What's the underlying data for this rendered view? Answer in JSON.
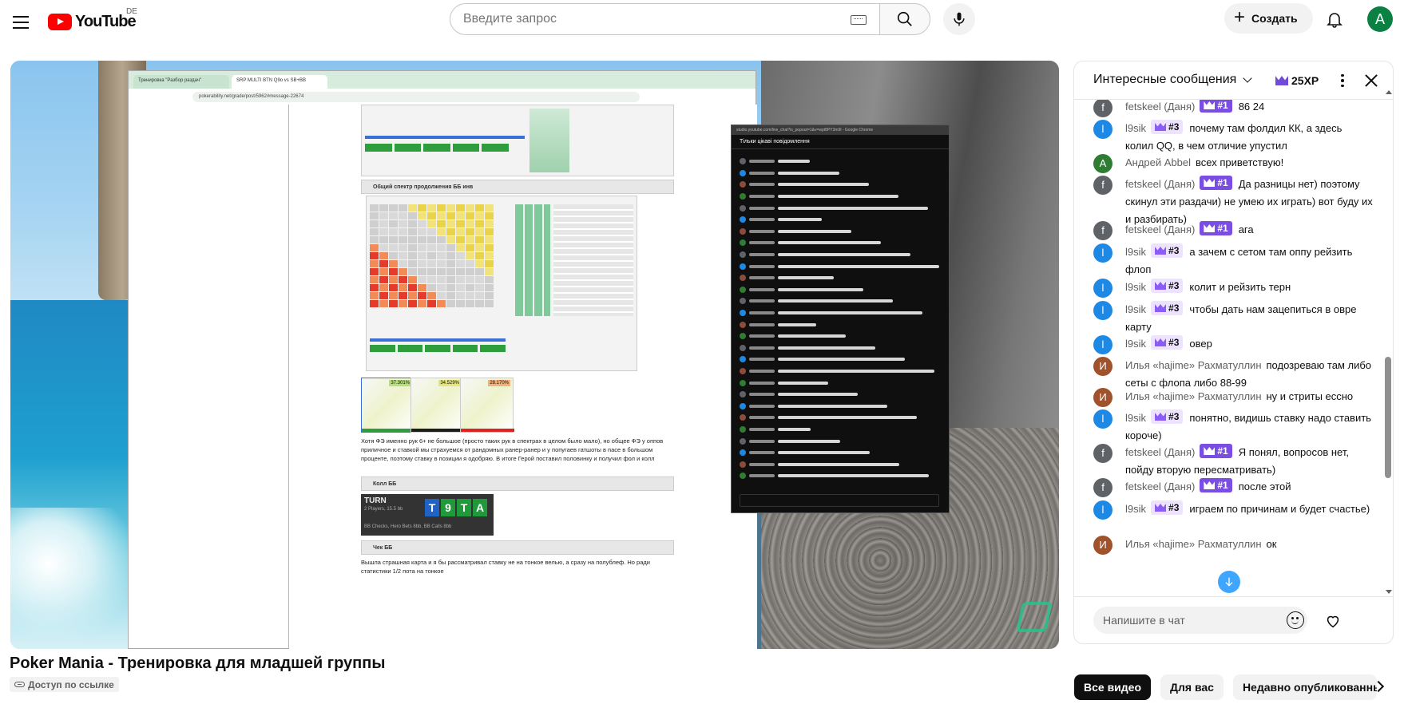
{
  "header": {
    "logo_text": "YouTube",
    "region": "DE",
    "search_placeholder": "Введите запрос",
    "create_label": "Создать",
    "avatar_letter": "A"
  },
  "video": {
    "title": "Poker Mania - Тренировка для младшей группы",
    "visibility": "Доступ по ссылке",
    "frame": {
      "tab_1": "Тренировка \"Разбор раздач\"",
      "tab_2": "SRP MULTI BTN Q9o vs SB+BB",
      "url": "pokerability.net/grade/post/5962#message-22674",
      "overlay_chat_bar": "studio.youtube.com/live_chat?is_popout=1&v=wpt8PY3m9l - Google Chrome",
      "overlay_chat_title": "Тільки цікаві повідомлення",
      "section_1": "Общий спектр продолжения ББ инв",
      "section_2": "Колл ББ",
      "section_3": "Чек ББ",
      "pct_1": "37.301%",
      "pct_2": "34.529%",
      "pct_3": "28.170%",
      "post_1": "Хотя ФЭ именно рук 6+ не большое (просто таких рук в спектрах в целом было мало), но общее ФЭ у оппов приличное и ставкой мы страхуемся от рандомных ранер-ранер и у попугаев гатшоты в пасе в большом проценте, поэтому ставку в позиции я одобряю. В итоге Герой поставил половинку и получил фол и колл",
      "post_2": "Вышла страшная карта и я бы рассматривал ставку не на тонкое велью, а сразу на полублеф. Но ради статистики 1/2 пота на тонкое",
      "turn_title": "TURN",
      "turn_sub": "2 Players, 15.5 bb",
      "turn_line": "BB Checks, Hero Bets 8bb, BB Calls 8bb",
      "turn_cards": [
        "T",
        "9",
        "T",
        "A"
      ],
      "turn_card_colors": [
        "#1f63c6",
        "#1f9a3a",
        "#1f9a3a",
        "#1f9a3a"
      ]
    }
  },
  "chat": {
    "title": "Интересные сообщения",
    "xp": "25XP",
    "input_placeholder": "Напишите в чат",
    "messages": [
      {
        "author": "fetskeel (Даня)",
        "badge": "#1",
        "text": "86 24",
        "initial": "f",
        "color": "#5f6368"
      },
      {
        "author": "l9sik",
        "badge": "#3",
        "text": "почему там фолдил КК, а здесь колил QQ, в чем отличие упустил",
        "initial": "l",
        "color": "#1e88e5"
      },
      {
        "author": "Андрей Abbel",
        "badge": "",
        "text": "всех приветствую!",
        "initial": "A",
        "color": "#2e7d32"
      },
      {
        "author": "fetskeel (Даня)",
        "badge": "#1",
        "text": "Да разницы нет) поэтому скинул эти раздачи) не умею их играть) вот буду их и разбирать)",
        "initial": "f",
        "color": "#5f6368"
      },
      {
        "author": "fetskeel (Даня)",
        "badge": "#1",
        "text": "ага",
        "initial": "f",
        "color": "#5f6368"
      },
      {
        "author": "l9sik",
        "badge": "#3",
        "text": "а зачем с сетом там оппу рейзить флоп",
        "initial": "l",
        "color": "#1e88e5"
      },
      {
        "author": "l9sik",
        "badge": "#3",
        "text": "колит и рейзить терн",
        "initial": "l",
        "color": "#1e88e5"
      },
      {
        "author": "l9sik",
        "badge": "#3",
        "text": "чтобы дать нам зацепиться в овре карту",
        "initial": "l",
        "color": "#1e88e5"
      },
      {
        "author": "l9sik",
        "badge": "#3",
        "text": "овер",
        "initial": "l",
        "color": "#1e88e5"
      },
      {
        "author": "Илья «hajime» Рахматуллин",
        "badge": "",
        "text": "подозреваю там либо сеты с флопа либо 88-99",
        "initial": "И",
        "color": "#a0522d"
      },
      {
        "author": "Илья «hajime» Рахматуллин",
        "badge": "",
        "text": "ну и стриты ессно",
        "initial": "И",
        "color": "#a0522d"
      },
      {
        "author": "l9sik",
        "badge": "#3",
        "text": "понятно, видишь ставку надо ставить короче)",
        "initial": "l",
        "color": "#1e88e5"
      },
      {
        "author": "fetskeel (Даня)",
        "badge": "#1",
        "text": "Я понял, вопросов нет, пойду вторую пересматривать)",
        "initial": "f",
        "color": "#5f6368"
      },
      {
        "author": "fetskeel (Даня)",
        "badge": "#1",
        "text": "после этой",
        "initial": "f",
        "color": "#5f6368"
      },
      {
        "author": "l9sik",
        "badge": "#3",
        "text": "играем по причинам и будет счастье)",
        "initial": "l",
        "color": "#1e88e5"
      },
      {
        "author": "Илья «hajime» Рахматуллин",
        "badge": "",
        "text": "ок",
        "initial": "И",
        "color": "#a0522d"
      }
    ]
  },
  "filters": {
    "items": [
      "Все видео",
      "Для вас",
      "Недавно опубликованные"
    ]
  },
  "colors": {
    "brand_red": "#ff0000",
    "badge_purple": "#7a4de3",
    "badge_light": "#ede3ff",
    "accent_blue": "#3ea6ff"
  }
}
